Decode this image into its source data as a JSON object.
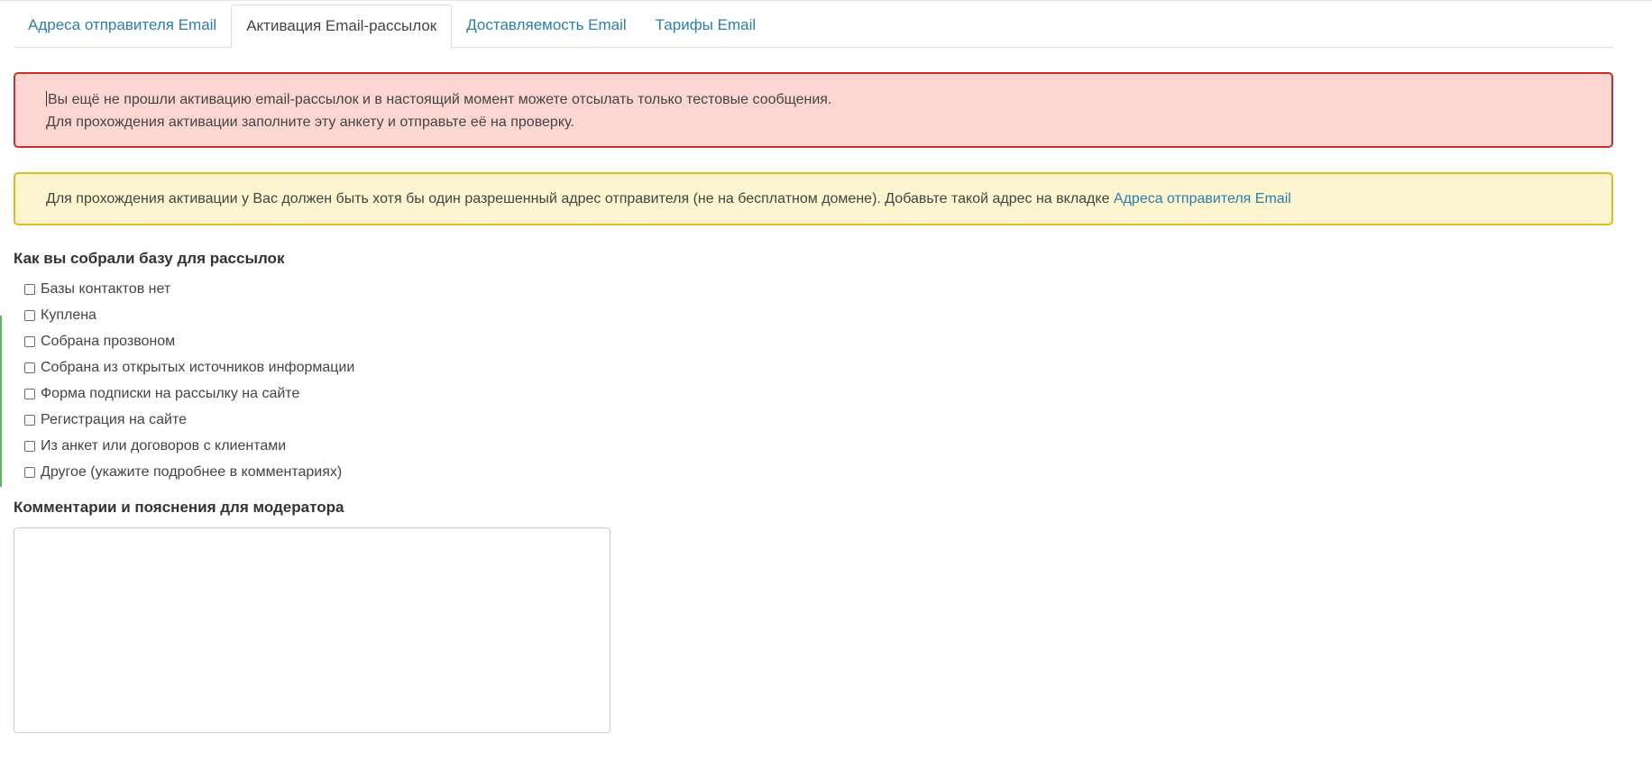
{
  "tabs": [
    {
      "label": "Адреса отправителя Email",
      "active": false
    },
    {
      "label": "Активация Email-рассылок",
      "active": true
    },
    {
      "label": "Доставляемость Email",
      "active": false
    },
    {
      "label": "Тарифы Email",
      "active": false
    }
  ],
  "alerts": {
    "danger": {
      "line1": "Вы ещё не прошли активацию email-рассылок и в настоящий момент можете отсылать только тестовые сообщения.",
      "line2": "Для прохождения активации заполните эту анкету и отправьте её на проверку."
    },
    "warning": {
      "text": "Для прохождения активации у Вас должен быть хотя бы один разрешенный адрес отправителя (не на бесплатном домене). Добавьте такой адрес на вкладке ",
      "link": "Адреса отправителя Email"
    }
  },
  "form": {
    "source_title": "Как вы собрали базу для рассылок",
    "options": [
      "Базы контактов нет",
      "Куплена",
      "Собрана прозвоном",
      "Собрана из открытых источников информации",
      "Форма подписки на рассылку на сайте",
      "Регистрация на сайте",
      "Из анкет или договоров с клиентами",
      "Другое (укажите подробнее в комментариях)"
    ],
    "comments_title": "Комментарии и пояснения для модератора",
    "comments_value": ""
  },
  "colors": {
    "link": "#2a7fad",
    "danger_bg": "#fdd6d3",
    "danger_border": "#c9302c",
    "warning_bg": "#fdf5cf",
    "warning_border": "#e5b91e"
  }
}
